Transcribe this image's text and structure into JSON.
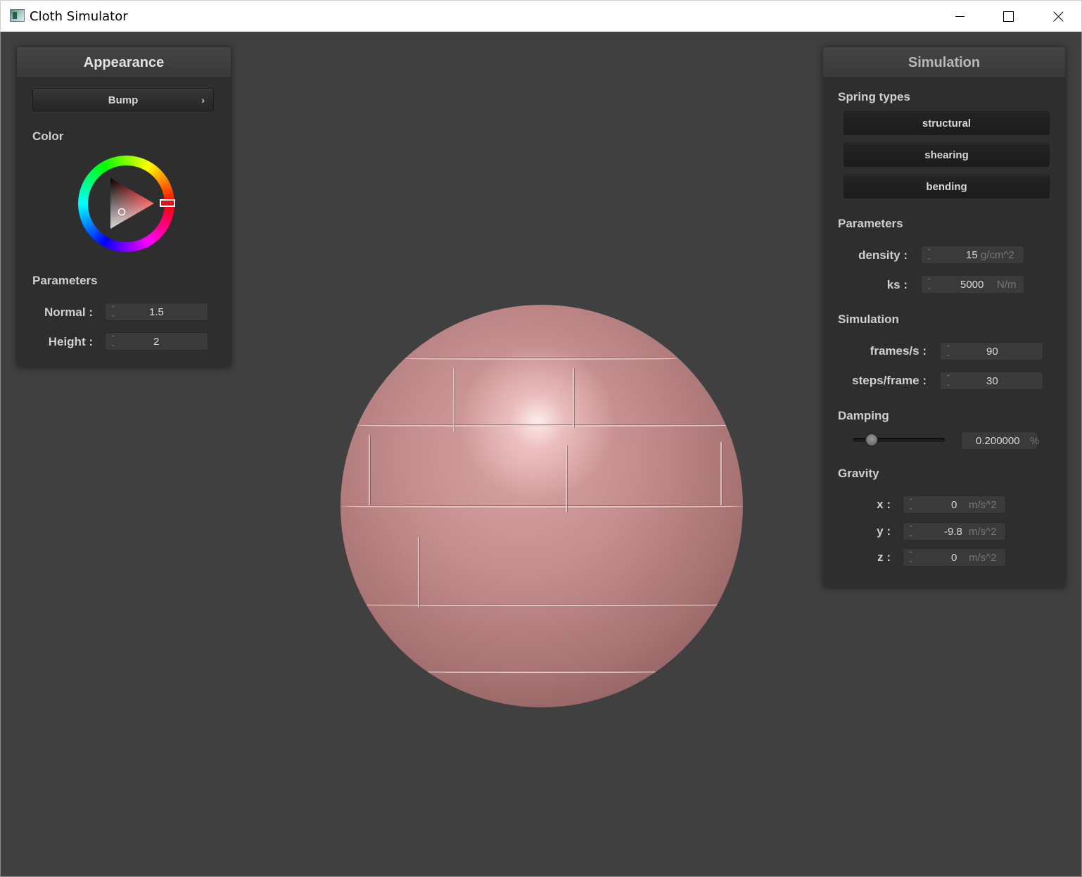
{
  "window": {
    "title": "Cloth Simulator"
  },
  "appearance": {
    "title": "Appearance",
    "shader_select": "Bump",
    "color_label": "Color",
    "selected_color": "#e01414",
    "params_label": "Parameters",
    "normal_label": "Normal :",
    "normal_value": "1.5",
    "height_label": "Height :",
    "height_value": "2"
  },
  "simulation": {
    "title": "Simulation",
    "spring_types_label": "Spring types",
    "spring_buttons": {
      "structural": "structural",
      "shearing": "shearing",
      "bending": "bending"
    },
    "params_label": "Parameters",
    "density_label": "density :",
    "density_value": "15",
    "density_unit": "g/cm^2",
    "ks_label": "ks :",
    "ks_value": "5000",
    "ks_unit": "N/m",
    "sim_label": "Simulation",
    "fps_label": "frames/s :",
    "fps_value": "90",
    "steps_label": "steps/frame :",
    "steps_value": "30",
    "damping_label": "Damping",
    "damping_value": "0.200000",
    "damping_unit": "%",
    "damping_slider_fraction": 0.2,
    "gravity_label": "Gravity",
    "gx_label": "x :",
    "gx_value": "0",
    "gy_label": "y :",
    "gy_value": "-9.8",
    "gz_label": "z :",
    "gz_value": "0",
    "g_unit": "m/s^2"
  }
}
